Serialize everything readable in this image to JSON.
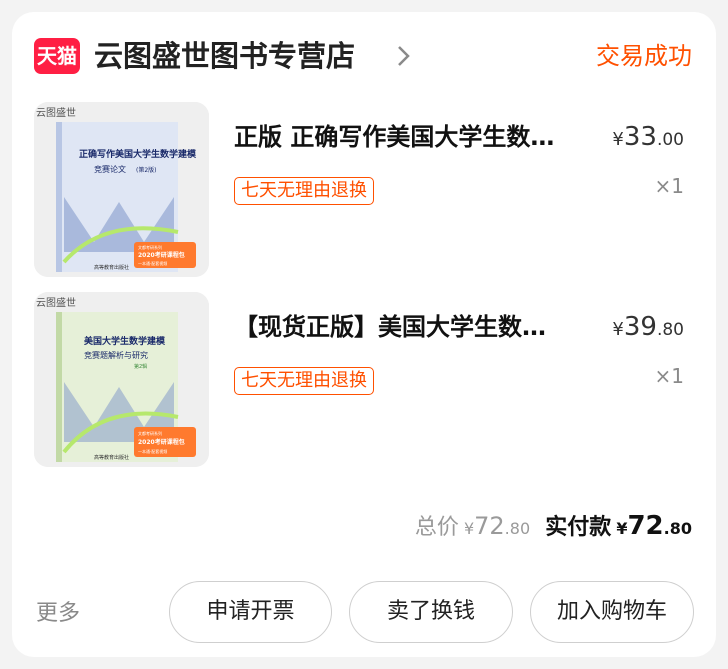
{
  "shop": {
    "logo_text": "天猫",
    "name": "云图盛世图书专营店",
    "status": "交易成功"
  },
  "items": [
    {
      "title": "正版 正确写作美国大学生数…",
      "price_currency": "¥",
      "price_int": "33",
      "price_dec": ".00",
      "tag": "七天无理由退换",
      "qty": "×1",
      "cover": {
        "brand": "云图盛世",
        "title_line1": "正确写作美国大学生数学建模",
        "title_line2": "竞赛论文",
        "title_edition": "(第2版)",
        "sticker_line1": "文都考研系列",
        "sticker_line2": "2020考研课程包",
        "sticker_line3": "一本通·配套视频",
        "publisher": "高等教育出版社",
        "bg": "#dfe6f4",
        "accent": "#c4d2ee"
      }
    },
    {
      "title": "【现货正版】美国大学生数…",
      "price_currency": "¥",
      "price_int": "39",
      "price_dec": ".80",
      "tag": "七天无理由退换",
      "qty": "×1",
      "cover": {
        "brand": "云图盛世",
        "title_line1": "美国大学生数学建模",
        "title_line2": "竞赛题解析与研究",
        "title_edition": "第2辑",
        "sticker_line1": "文都考研系列",
        "sticker_line2": "2020考研课程包",
        "sticker_line3": "一本通·配套视频",
        "publisher": "高等教育出版社",
        "bg": "#e6f0d8",
        "accent": "#cfe3b8"
      }
    }
  ],
  "totals": {
    "total_label": "总价",
    "total_currency": "¥",
    "total_int": "72",
    "total_dec": ".80",
    "paid_label": "实付款",
    "paid_currency": "¥",
    "paid_int": "72",
    "paid_dec": ".80"
  },
  "actions": {
    "more": "更多",
    "invoice": "申请开票",
    "resell": "卖了换钱",
    "add_to_cart": "加入购物车"
  },
  "colors": {
    "accent": "#ff5000",
    "tmall_red": "#ff1f44"
  }
}
